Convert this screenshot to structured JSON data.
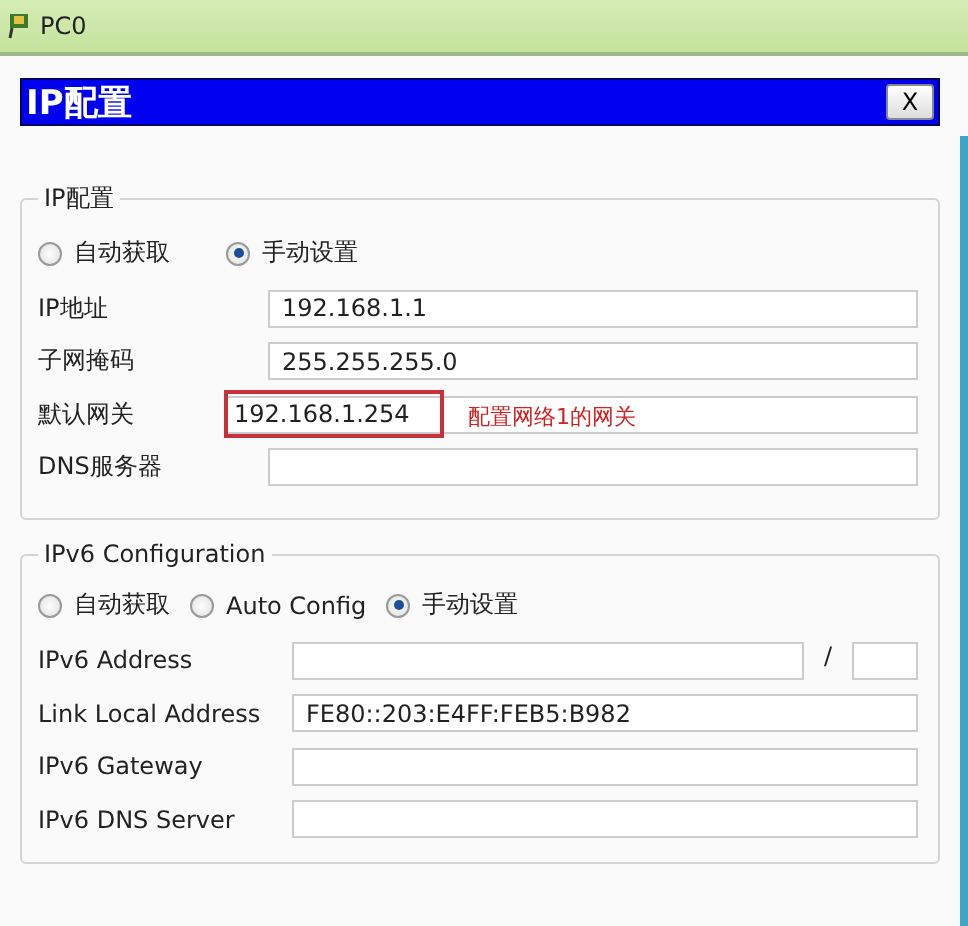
{
  "window": {
    "title": "PC0"
  },
  "dialog": {
    "title": "IP配置",
    "close": "X"
  },
  "ipv4": {
    "legend": "IP配置",
    "modes": [
      {
        "label": "自动获取",
        "selected": false
      },
      {
        "label": "手动设置",
        "selected": true
      }
    ],
    "fields": [
      {
        "label": "IP地址",
        "value": "192.168.1.1"
      },
      {
        "label": "子网掩码",
        "value": "255.255.255.0"
      },
      {
        "label": "默认网关",
        "value": "192.168.1.254",
        "annotation": "配置网络1的网关"
      },
      {
        "label": "DNS服务器"
      }
    ]
  },
  "ipv6": {
    "legend": "IPv6 Configuration",
    "modes": [
      {
        "label": "自动获取",
        "selected": false
      },
      {
        "label": "Auto Config",
        "selected": false
      },
      {
        "label": "手动设置",
        "selected": true
      }
    ],
    "fields": [
      {
        "label": "IPv6 Address",
        "prefix_separator": "/"
      },
      {
        "label": "Link Local Address",
        "value": "FE80::203:E4FF:FEB5:B982"
      },
      {
        "label": "IPv6 Gateway"
      },
      {
        "label": "IPv6 DNS Server"
      }
    ]
  }
}
